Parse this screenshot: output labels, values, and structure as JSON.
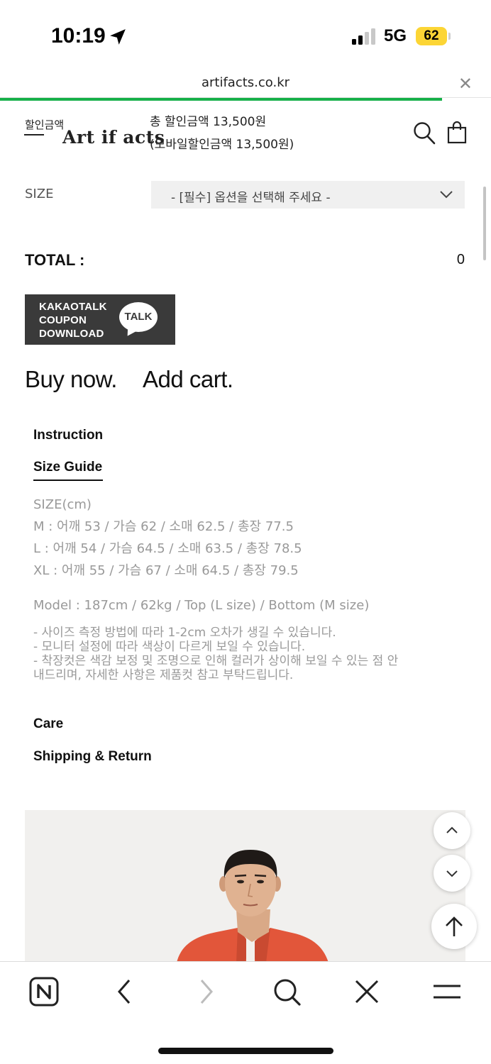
{
  "status_bar": {
    "time": "10:19",
    "network": "5G",
    "battery": "62",
    "battery_color": "#fcd535"
  },
  "browser": {
    "url": "artifacts.co.kr",
    "close_icon": "close-icon",
    "progress_color": "#17b04a",
    "load_progress": 0.9
  },
  "header": {
    "logo": "Art if acts",
    "discount_label": "할인금액",
    "discount_total": "총 할인금액 13,500원",
    "discount_mobile": "(모바일할인금액 13,500원)"
  },
  "options": {
    "size_label": "SIZE",
    "size_placeholder": "- [필수] 옵션을 선택해 주세요 -"
  },
  "total": {
    "label": "TOTAL :",
    "value": "0"
  },
  "kakao": {
    "line1": "KAKAOTALK",
    "line2": "COUPON",
    "line3": "DOWNLOAD",
    "talk": "TALK"
  },
  "actions": {
    "buy_now": "Buy now.",
    "add_cart": "Add cart."
  },
  "info": {
    "instruction": "Instruction",
    "size_guide": "Size Guide",
    "size_rows": [
      "SIZE(cm)",
      "M : 어깨 53 / 가슴 62 / 소매 62.5 / 총장 77.5",
      "L : 어깨 54 / 가슴 64.5 / 소매 63.5 / 총장 78.5",
      "XL : 어깨 55 / 가슴 67 / 소매 64.5 / 총장 79.5"
    ],
    "model": "Model : 187cm / 62kg / Top (L size) / Bottom (M size)",
    "notices": [
      "- 사이즈 측정 방법에 따라 1-2cm 오차가 생길 수 있습니다.",
      "- 모니터 설정에 따라 색상이 다르게 보일 수 있습니다.",
      "- 착장컷은 색감 보정 및 조명으로 인해 컬러가 상이해 보일 수 있는 점 안",
      "내드리며, 자세한 사항은 제품컷 참고 부탁드립니다."
    ],
    "care": "Care",
    "shipping": "Shipping & Return"
  },
  "toolbar": {
    "items": [
      "naver-home-icon",
      "back-icon",
      "forward-icon",
      "search-icon",
      "close-icon",
      "menu-icon"
    ]
  }
}
